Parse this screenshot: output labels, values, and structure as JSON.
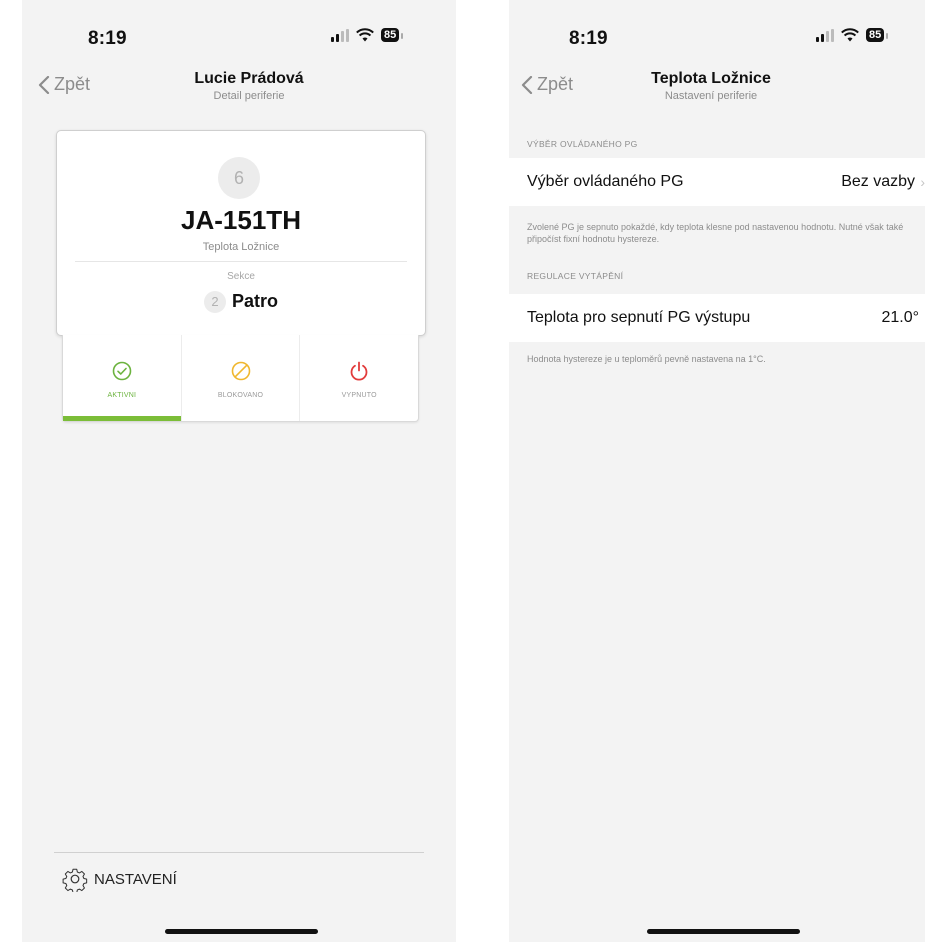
{
  "left": {
    "status": {
      "time": "8:19",
      "battery": "85"
    },
    "nav": {
      "back": "Zpět",
      "title": "Lucie Prádová",
      "subtitle": "Detail periferie"
    },
    "card": {
      "number": "6",
      "code": "JA-151TH",
      "place": "Teplota Ložnice",
      "section_label": "Sekce",
      "section_number": "2",
      "section_name": "Patro"
    },
    "modes": [
      {
        "label": "AKTIVNI",
        "color": "#6cb33f",
        "icon": "check-circle-icon"
      },
      {
        "label": "BLOKOVANO",
        "color": "#f0b72f",
        "icon": "blocked-icon"
      },
      {
        "label": "VYPNUTO",
        "color": "#e23b3b",
        "icon": "power-icon"
      }
    ],
    "settings_label": "NASTAVENÍ"
  },
  "right": {
    "status": {
      "time": "8:19",
      "battery": "85"
    },
    "nav": {
      "back": "Zpět",
      "title": "Teplota Ložnice",
      "subtitle": "Nastavení periferie"
    },
    "section1_header": "VÝBĚR OVLÁDANÉHO PG",
    "row1": {
      "label": "Výběr ovládaného PG",
      "value": "Bez vazby"
    },
    "note1": "Zvolené PG je sepnuto pokaždé, kdy teplota klesne pod nastavenou hodnotu. Nutné však také připočíst fixní hodnotu hystereze.",
    "section2_header": "REGULACE VYTÁPĚNÍ",
    "row2": {
      "label": "Teplota pro sepnutí PG výstupu",
      "value": "21.0°"
    },
    "note2": "Hodnota hystereze je u teploměrů pevně nastavena na 1°C."
  }
}
